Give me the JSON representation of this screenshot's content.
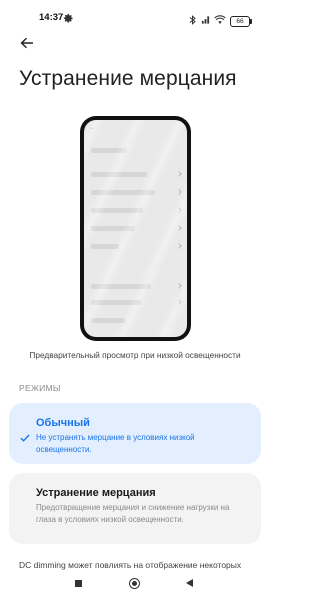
{
  "status_bar": {
    "time": "14:37",
    "battery": "66"
  },
  "page": {
    "title": "Устранение мерцания"
  },
  "preview": {
    "caption": "Предварительный просмотр при низкой освещенности"
  },
  "section": {
    "header": "РЕЖИМЫ"
  },
  "modes": [
    {
      "title": "Обычный",
      "description": "Не устранять мерцание в условиях низкой освещенности.",
      "selected": true
    },
    {
      "title": "Устранение мерцания",
      "description": "Предотвращение мерцания и снижение нагрузки на глаза в условиях низкой освещенности.",
      "selected": false
    }
  ],
  "footnote": "DC dimming может повлиять на отображение некоторых",
  "colors": {
    "accent": "#1a73e8",
    "selected_bg": "#e3efff",
    "card_bg": "#f3f3f3"
  },
  "icons": [
    "gear-icon",
    "bluetooth-icon",
    "wifi-icon",
    "battery-icon",
    "back-arrow-icon",
    "check-icon"
  ]
}
